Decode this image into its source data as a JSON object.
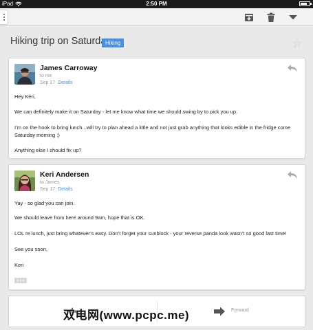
{
  "status_bar": {
    "device": "iPad",
    "time": "2:50 PM",
    "battery_level": 0.75
  },
  "toolbar": {
    "icons": [
      "archive-icon",
      "trash-icon",
      "chevron-down-icon"
    ]
  },
  "thread": {
    "subject": "Hiking trip on Saturday",
    "label": "Hiking",
    "starred": false
  },
  "messages": [
    {
      "sender": "James Carroway",
      "to": "to me",
      "date": "Sep 17",
      "details_label": "Details",
      "body": [
        "Hey Keri,",
        "We can definitely make it on Saturday - let me know what time we should swing by to pick you up.",
        "I’m on the hook to bring lunch...will try to plan ahead a little and not just grab anything that looks edible in the fridge come Saturday morning :)",
        "Anything else I should fix up?"
      ]
    },
    {
      "sender": "Keri Andersen",
      "to": "to James",
      "date": "Sep 17",
      "details_label": "Details",
      "body": [
        "Yay - so glad you can join.",
        "We should leave from here around 9am, hope that is OK.",
        "LOL re lunch, just bring whatever’s easy. Don’t forget your sunblock - your reverse panda look wasn’t so good last time!",
        "See you soon,",
        "Keri"
      ]
    }
  ],
  "actions": {
    "forward_label": "Forward"
  },
  "watermark": "双电网(www.pcpc.me)",
  "colors": {
    "accent": "#4a8fd8",
    "label_bg": "#4a8fd8",
    "background": "#e9e9e9"
  }
}
